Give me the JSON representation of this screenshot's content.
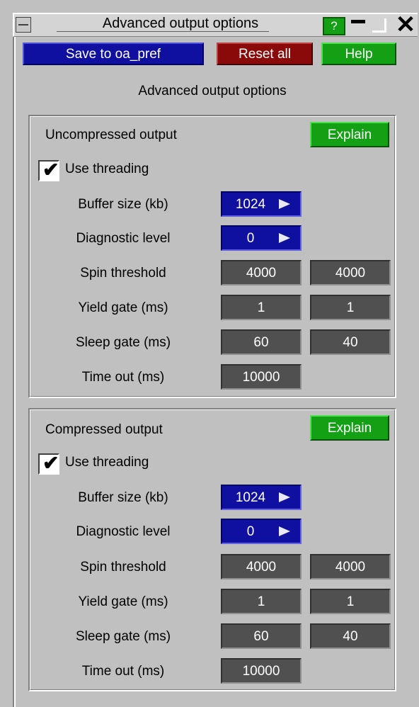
{
  "window": {
    "title": "Advanced output options",
    "help_icon_label": "?"
  },
  "toolbar": {
    "save_label": "Save to oa_pref",
    "reset_label": "Reset all",
    "help_label": "Help"
  },
  "subtitle": "Advanced output options",
  "panels": [
    {
      "heading": "Uncompressed output",
      "explain_label": "Explain",
      "use_threading_label": "Use threading",
      "use_threading_checked": true,
      "buffer_size_label": "Buffer size (kb)",
      "buffer_size_value": "1024",
      "diagnostic_label": "Diagnostic level",
      "diagnostic_value": "0",
      "spin_label": "Spin threshold",
      "spin_values": [
        "4000",
        "4000"
      ],
      "yield_label": "Yield gate (ms)",
      "yield_values": [
        "1",
        "1"
      ],
      "sleep_label": "Sleep gate (ms)",
      "sleep_values": [
        "60",
        "40"
      ],
      "timeout_label": "Time out (ms)",
      "timeout_value": "10000"
    },
    {
      "heading": "Compressed output",
      "explain_label": "Explain",
      "use_threading_label": "Use threading",
      "use_threading_checked": true,
      "buffer_size_label": "Buffer size (kb)",
      "buffer_size_value": "1024",
      "diagnostic_label": "Diagnostic level",
      "diagnostic_value": "0",
      "spin_label": "Spin threshold",
      "spin_values": [
        "4000",
        "4000"
      ],
      "yield_label": "Yield gate (ms)",
      "yield_values": [
        "1",
        "1"
      ],
      "sleep_label": "Sleep gate (ms)",
      "sleep_values": [
        "60",
        "40"
      ],
      "timeout_label": "Time out (ms)",
      "timeout_value": "10000"
    }
  ],
  "colors": {
    "background": "#c0c0c0",
    "blue_button": "#1010a0",
    "red_button": "#8a0a0a",
    "green_button": "#14a014",
    "dark_field": "#505050"
  },
  "icons": {
    "window_menu": "window-menu-icon",
    "minimize": "minimize-icon",
    "maximize": "maximize-icon",
    "close": "close-icon",
    "checkmark": "checkmark-icon",
    "dropdown": "dropdown-arrow-icon"
  }
}
